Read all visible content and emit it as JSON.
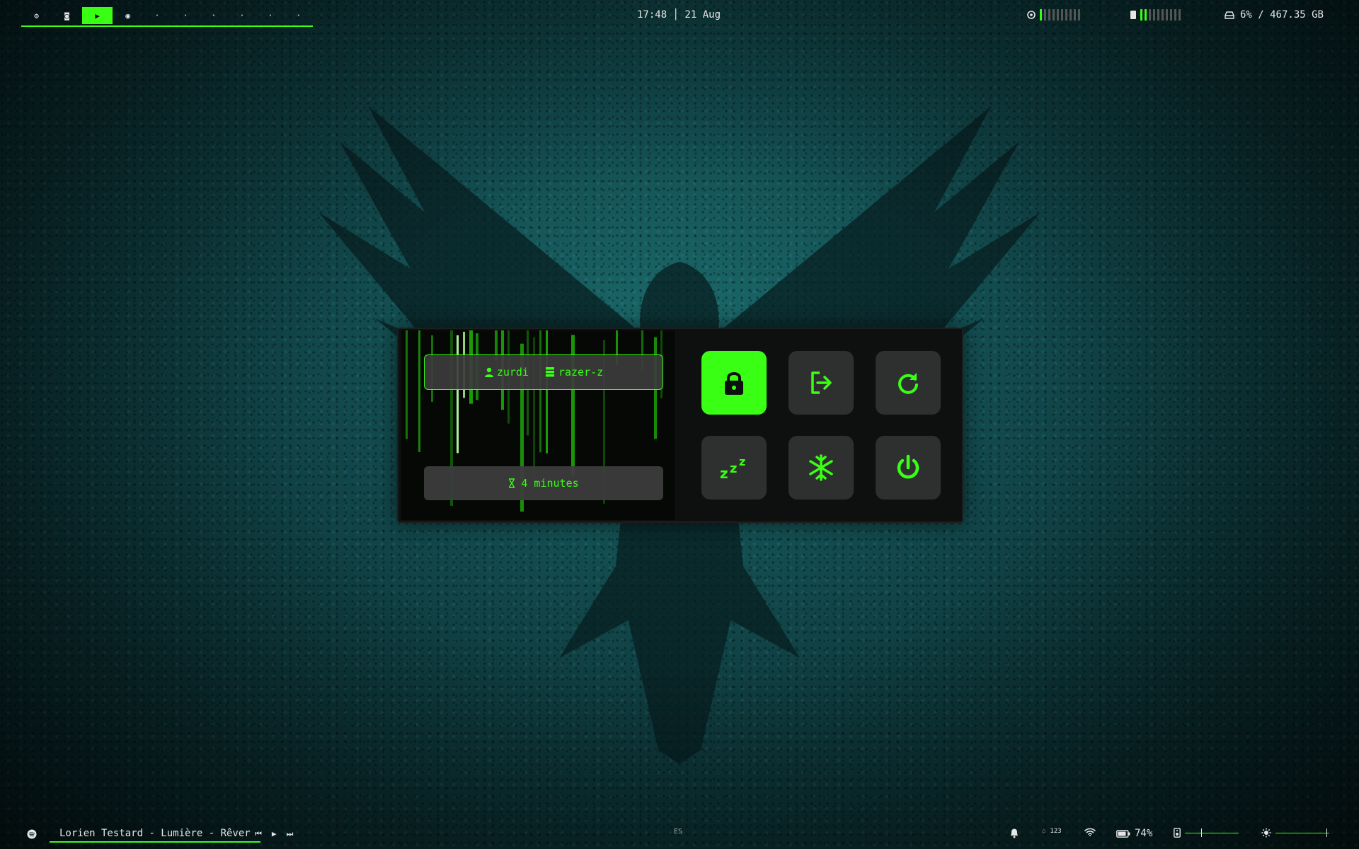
{
  "colors": {
    "accent": "#39ff14",
    "panel": "#0e0f0f",
    "button": "#2e3030"
  },
  "topbar": {
    "workspaces": [
      {
        "icon": "settings-icon",
        "label": "⚙"
      },
      {
        "icon": "screenshot-icon",
        "label": "◙"
      },
      {
        "icon": "terminal-icon",
        "label": "▶"
      },
      {
        "icon": "spotify-icon",
        "label": "◉"
      }
    ],
    "empty_workspaces": [
      "·",
      "·",
      "·",
      "·",
      "·",
      "·"
    ],
    "clock": "17:48 │ 21 Aug",
    "cpu": {
      "icon": "cpu-icon",
      "level": 0.1
    },
    "memory": {
      "icon": "memory-icon",
      "level": 0.2
    },
    "disk": "6% / 467.35 GB"
  },
  "powermenu": {
    "user": "zurdi",
    "host": "razer-z",
    "uptime": "4 minutes",
    "buttons": [
      {
        "name": "lock",
        "icon": "lock-icon",
        "active": true
      },
      {
        "name": "logout",
        "icon": "logout-icon",
        "active": false
      },
      {
        "name": "reboot",
        "icon": "reboot-icon",
        "active": false
      },
      {
        "name": "sleep",
        "icon": "sleep-icon",
        "active": false
      },
      {
        "name": "hibernate",
        "icon": "snowflake-icon",
        "active": false
      },
      {
        "name": "shutdown",
        "icon": "power-icon",
        "active": false
      }
    ]
  },
  "bottombar": {
    "track": "Lorien Testard - Lumière - Rêver",
    "keyboard_layout": "ES",
    "lock_keys": "123",
    "battery": "74%",
    "volume_level": 0.3,
    "brightness_level": 0.95
  }
}
